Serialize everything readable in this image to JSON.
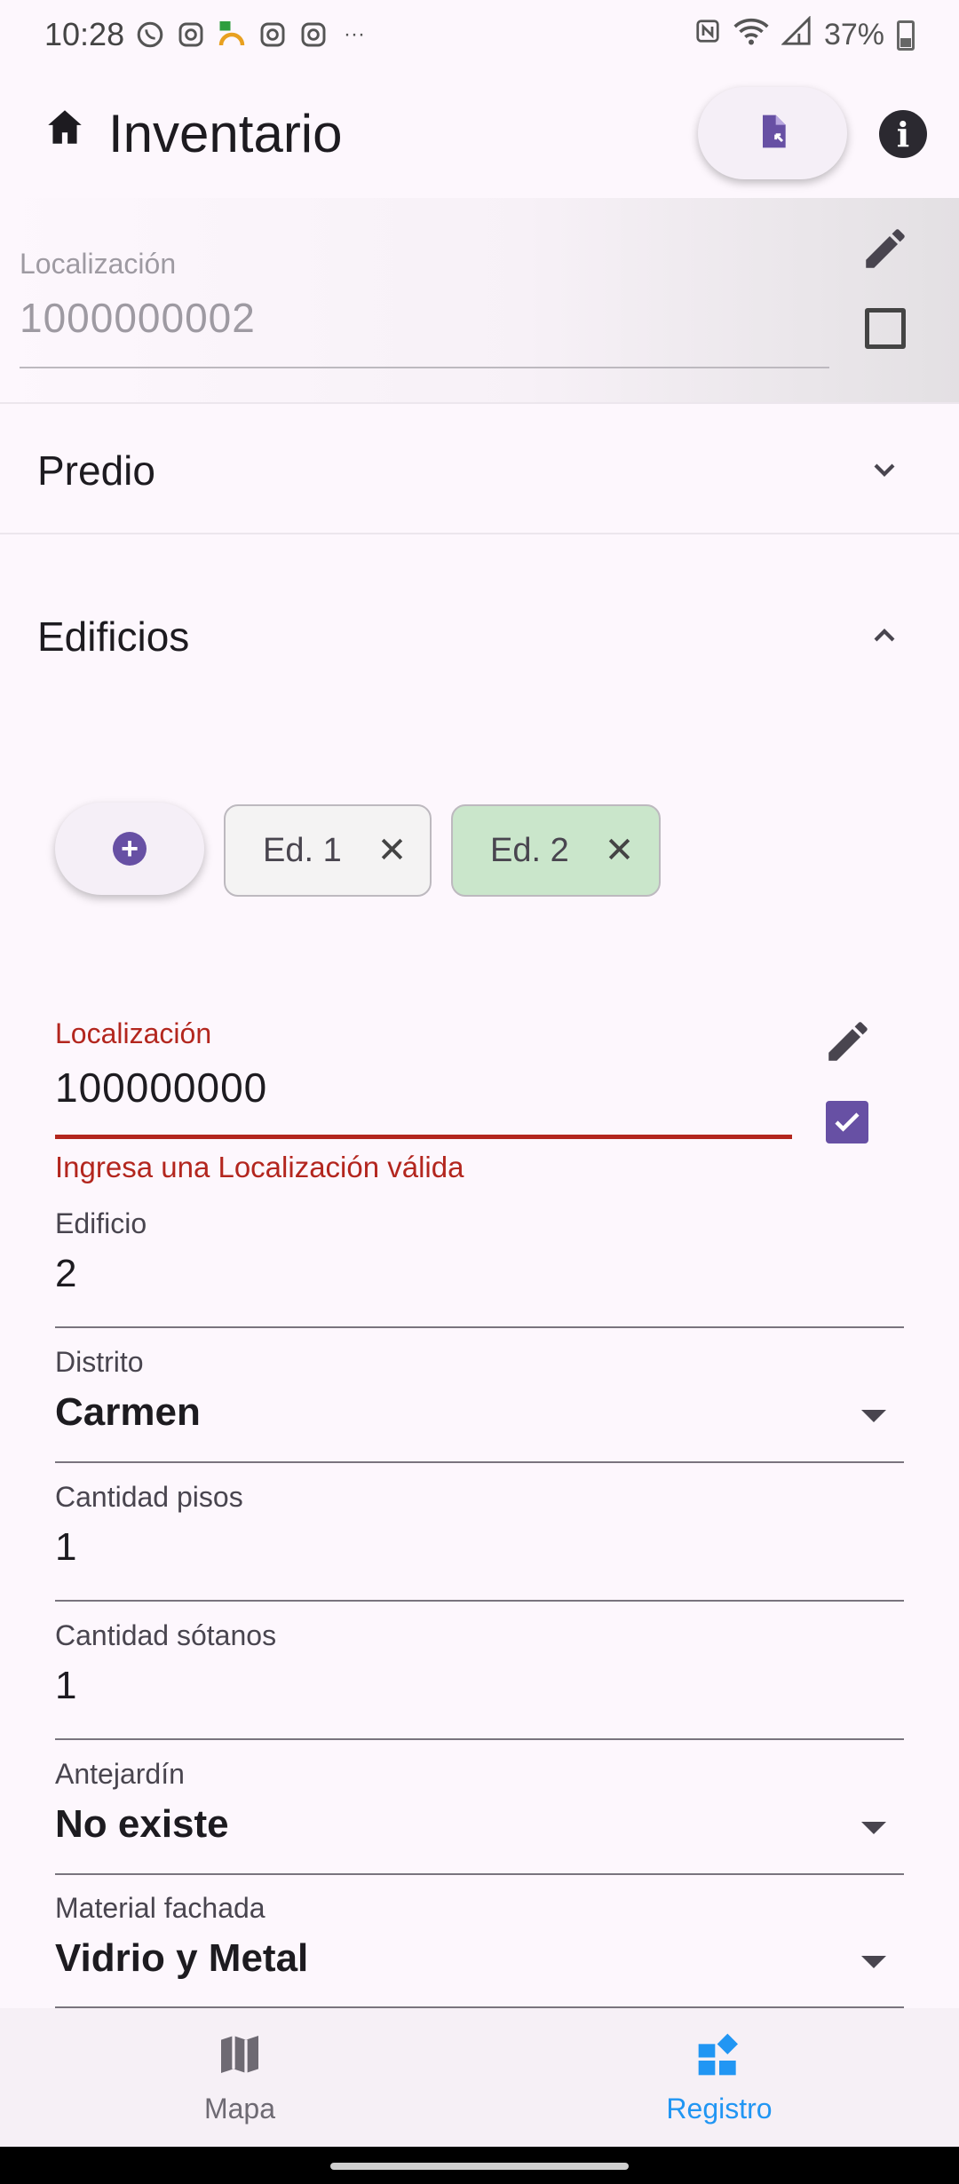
{
  "status_bar": {
    "time": "10:28",
    "battery": "37%",
    "left_icons": [
      "whatsapp-icon",
      "instagram-icon",
      "td-app-icon",
      "instagram-icon",
      "instagram-icon",
      "more-icon"
    ],
    "right_icons": [
      "nfc-icon",
      "wifi-icon",
      "signal-icon",
      "battery-icon"
    ]
  },
  "app_bar": {
    "title": "Inventario",
    "home_icon": "home-icon",
    "action_icon": "document-export-icon",
    "info_icon": "info-icon"
  },
  "location": {
    "label": "Localización",
    "value": "1000000002",
    "checked": false
  },
  "sections": {
    "predio": {
      "title": "Predio",
      "expanded": false
    },
    "edificios": {
      "title": "Edificios",
      "expanded": true
    }
  },
  "buildings": {
    "chips": [
      {
        "label": "Ed. 1",
        "selected": false
      },
      {
        "label": "Ed. 2",
        "selected": true
      }
    ],
    "form": {
      "localizacion": {
        "label": "Localización",
        "value": "100000000",
        "error": "Ingresa una Localización válida",
        "checked": true
      },
      "edificio": {
        "label": "Edificio",
        "value": "2"
      },
      "distrito": {
        "label": "Distrito",
        "value": "Carmen"
      },
      "cantidad_pisos": {
        "label": "Cantidad pisos",
        "value": "1"
      },
      "cantidad_sotanos": {
        "label": "Cantidad sótanos",
        "value": "1"
      },
      "antejardin": {
        "label": "Antejardín",
        "value": "No existe"
      },
      "material_fachada": {
        "label": "Material fachada",
        "value": "Vidrio y Metal"
      }
    }
  },
  "bottom_nav": {
    "items": [
      {
        "label": "Mapa",
        "icon": "map-icon",
        "active": false
      },
      {
        "label": "Registro",
        "icon": "dashboard-icon",
        "active": true
      }
    ]
  },
  "colors": {
    "primary": "#6750a4",
    "error": "#b3261e",
    "selected_chip": "#cae6cb",
    "active_nav": "#2196f3"
  }
}
